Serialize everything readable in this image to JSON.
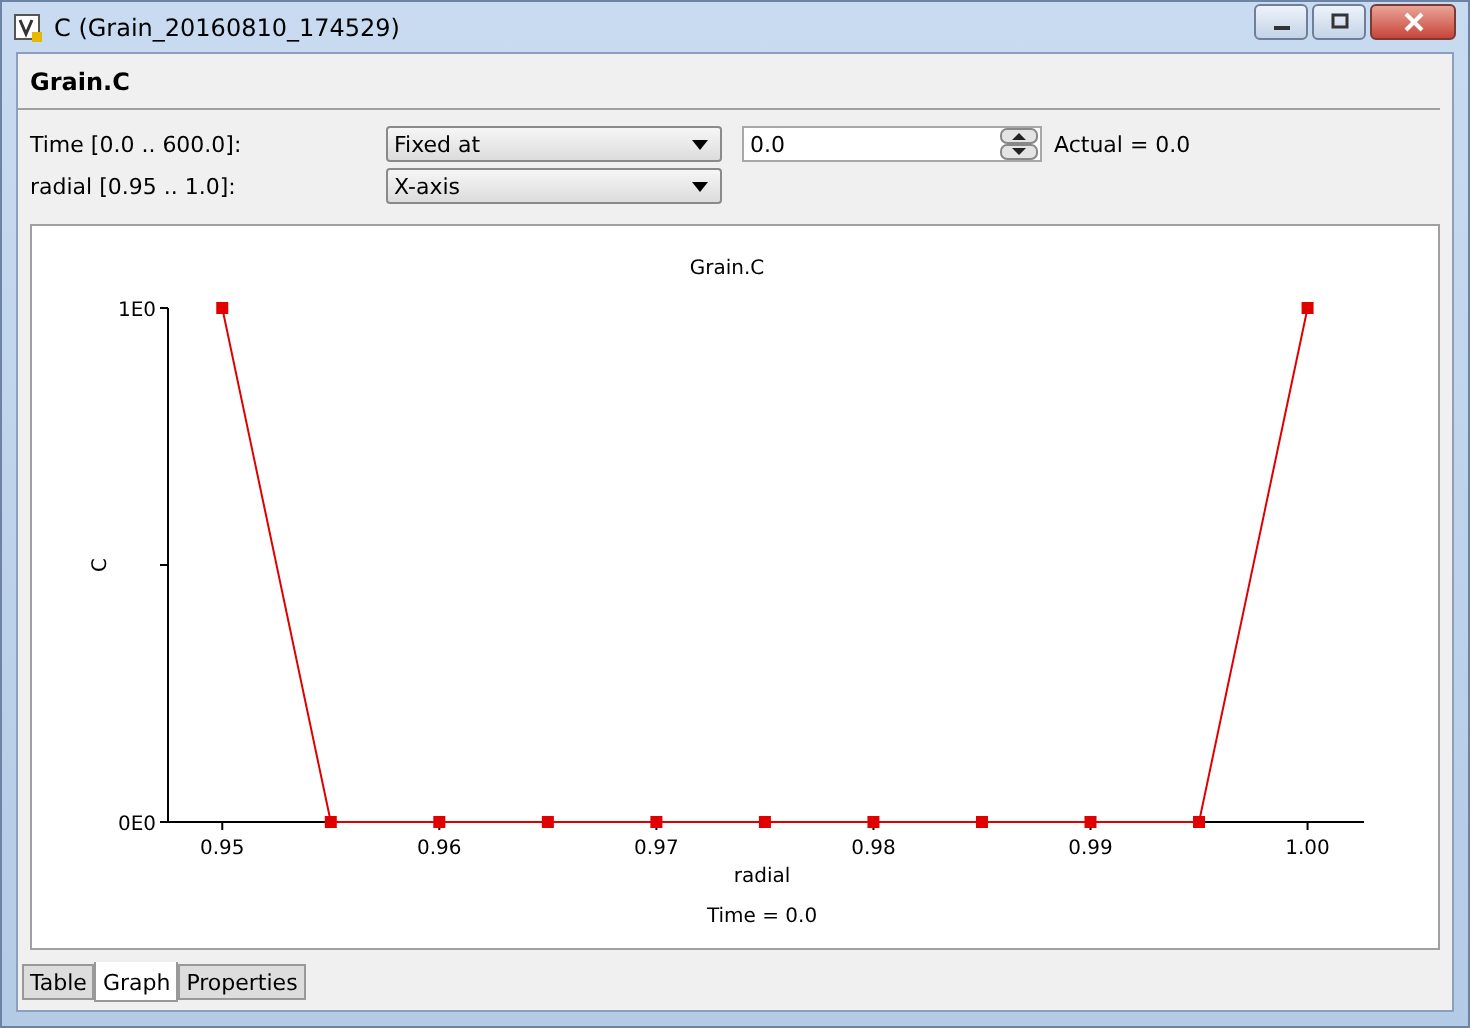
{
  "window": {
    "title": "C  (Grain_20160810_174529)"
  },
  "header": "Grain.C",
  "parameters": [
    {
      "label": "Time [0.0 .. 600.0]:",
      "mode": "Fixed at",
      "value": "0.0",
      "actual": "Actual = 0.0"
    },
    {
      "label": "radial [0.95 .. 1.0]:",
      "mode": "X-axis"
    }
  ],
  "graph": {
    "chart_data": {
      "type": "line",
      "title": "Grain.C",
      "xlabel": "radial",
      "ylabel": "C",
      "x": [
        0.95,
        0.955,
        0.96,
        0.965,
        0.97,
        0.975,
        0.98,
        0.985,
        0.99,
        0.995,
        1.0
      ],
      "series": [
        {
          "color": "#e00000",
          "marker": "square",
          "values": [
            1,
            0,
            0,
            0,
            0,
            0,
            0,
            0,
            0,
            0,
            1
          ]
        }
      ],
      "xlim": [
        0.9475,
        1.0026
      ],
      "ylim": [
        0,
        1
      ],
      "xticks": [
        {
          "value": 0.95,
          "label": "0.95"
        },
        {
          "value": 0.96,
          "label": "0.96"
        },
        {
          "value": 0.97,
          "label": "0.97"
        },
        {
          "value": 0.98,
          "label": "0.98"
        },
        {
          "value": 0.99,
          "label": "0.99"
        },
        {
          "value": 1.0,
          "label": "1.00"
        }
      ],
      "yticks": [
        {
          "value": 0,
          "label": "0E0"
        },
        {
          "value": 1,
          "label": "1E0"
        }
      ],
      "annotations": [
        "Time = 0.0"
      ]
    }
  },
  "tabs": [
    {
      "label": "Table",
      "selected": false
    },
    {
      "label": "Graph",
      "selected": true
    },
    {
      "label": "Properties",
      "selected": false
    }
  ]
}
